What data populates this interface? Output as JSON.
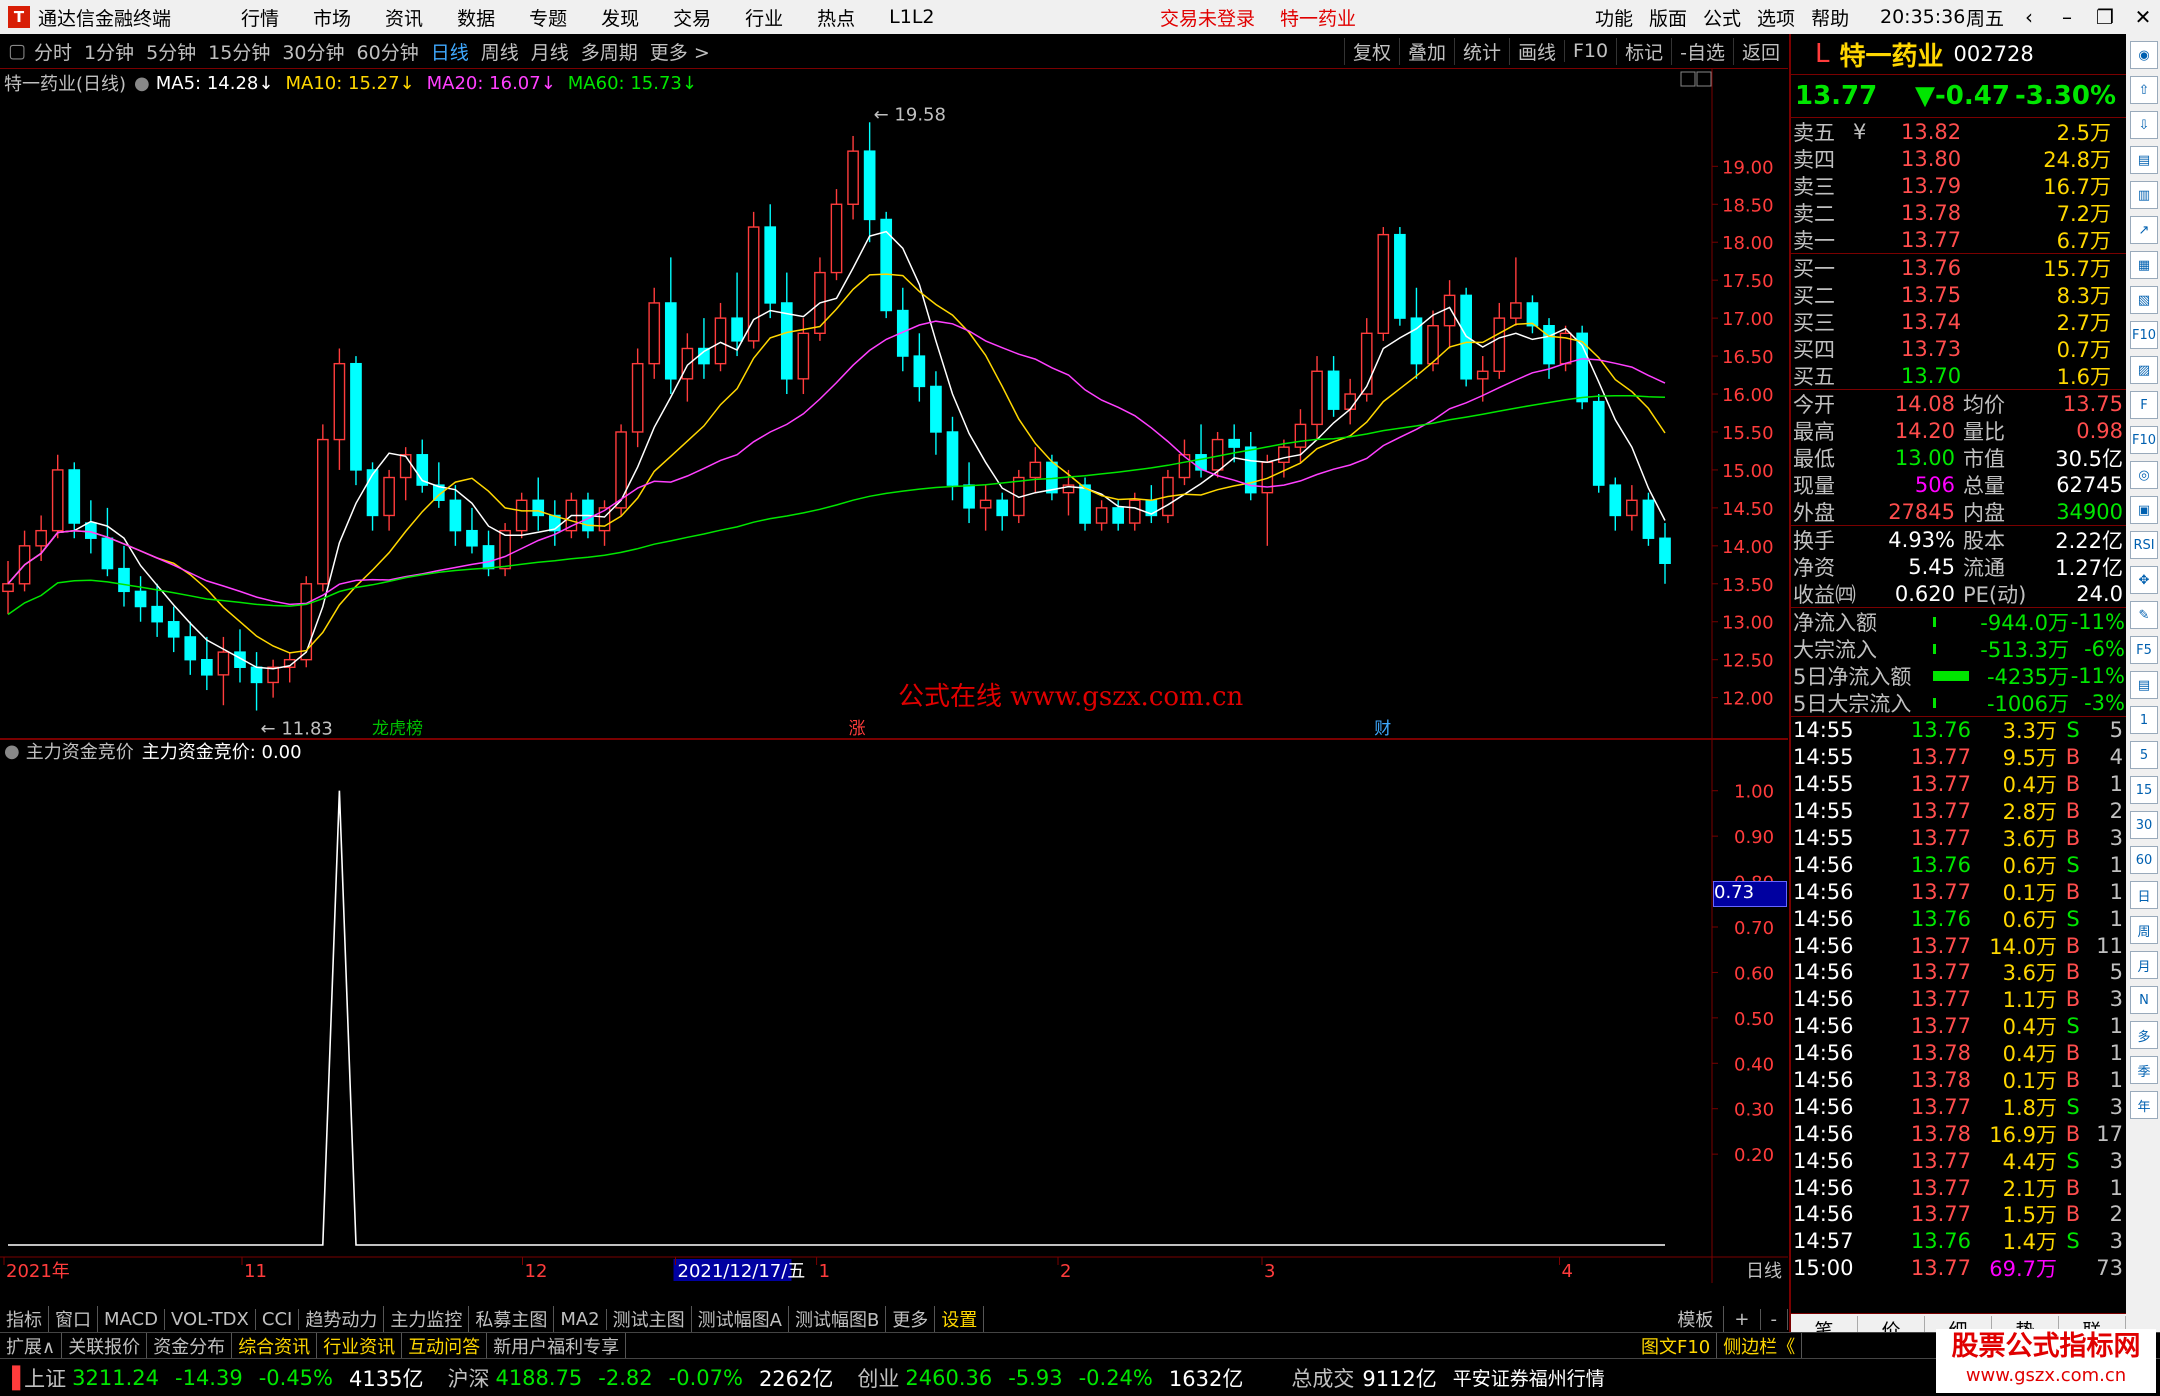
{
  "app": {
    "title": "通达信金融终端",
    "menus": [
      "行情",
      "市场",
      "资讯",
      "数据",
      "专题",
      "发现",
      "交易",
      "行业",
      "热点",
      "L1L2"
    ],
    "login_status": "交易未登录",
    "stock_name_header": "特一药业",
    "right_menus": [
      "功能",
      "版面",
      "公式",
      "选项",
      "帮助"
    ],
    "time": "20:35:36",
    "weekday": "周五",
    "logo_char": "T"
  },
  "period_bar": {
    "periods": [
      "分时",
      "1分钟",
      "5分钟",
      "15分钟",
      "30分钟",
      "60分钟",
      "日线",
      "周线",
      "月线",
      "多周期",
      "更多 >"
    ],
    "active": "日线",
    "tools": [
      "复权",
      "叠加",
      "统计",
      "画线",
      "F10",
      "标记",
      "-自选",
      "返回"
    ]
  },
  "main_chart": {
    "header_title": "特一药业(日线)",
    "ma": [
      {
        "label": "MA5: 14.28↓",
        "color": "#ffffff"
      },
      {
        "label": "MA10: 15.27↓",
        "color": "#ffd700"
      },
      {
        "label": "MA20: 16.07↓",
        "color": "#ff40ff"
      },
      {
        "label": "MA60: 15.73↓",
        "color": "#00e600"
      }
    ],
    "high_label": "19.58",
    "low_label": "11.83",
    "watermark": "公式在线 www.gszx.com.cn",
    "markers": [
      "龙虎榜",
      "涨",
      "财"
    ],
    "price_ticks": [
      "19.00",
      "18.50",
      "18.00",
      "17.50",
      "17.00",
      "16.50",
      "16.00",
      "15.50",
      "15.00",
      "14.50",
      "14.00",
      "13.50",
      "13.00",
      "12.50",
      "12.00"
    ]
  },
  "chart_data": [
    {
      "type": "candlestick",
      "title": "特一药业(日线)",
      "ylim": [
        11.6,
        19.9
      ],
      "high": 19.58,
      "low": 11.83,
      "x_labels": [
        "2021年",
        "11",
        "12",
        "2021/12/17/五",
        "1",
        "2",
        "3",
        "4"
      ],
      "ohlc": [
        [
          13.4,
          13.8,
          13.1,
          13.5
        ],
        [
          13.5,
          14.2,
          13.4,
          14.0
        ],
        [
          14.0,
          14.4,
          13.8,
          14.2
        ],
        [
          14.2,
          15.2,
          14.1,
          15.0
        ],
        [
          15.0,
          15.1,
          14.1,
          14.3
        ],
        [
          14.3,
          14.6,
          13.9,
          14.1
        ],
        [
          14.1,
          14.5,
          13.6,
          13.7
        ],
        [
          13.7,
          14.0,
          13.2,
          13.4
        ],
        [
          13.4,
          13.6,
          13.0,
          13.2
        ],
        [
          13.2,
          13.5,
          12.8,
          13.0
        ],
        [
          13.0,
          13.2,
          12.6,
          12.8
        ],
        [
          12.8,
          13.0,
          12.3,
          12.5
        ],
        [
          12.5,
          12.8,
          12.1,
          12.3
        ],
        [
          12.3,
          12.8,
          11.9,
          12.6
        ],
        [
          12.6,
          12.9,
          12.2,
          12.4
        ],
        [
          12.4,
          12.6,
          11.83,
          12.2
        ],
        [
          12.2,
          12.5,
          12.0,
          12.4
        ],
        [
          12.4,
          12.6,
          12.2,
          12.5
        ],
        [
          12.5,
          13.6,
          12.4,
          13.5
        ],
        [
          13.5,
          15.6,
          13.4,
          15.4
        ],
        [
          15.4,
          16.6,
          15.0,
          16.4
        ],
        [
          16.4,
          16.5,
          14.8,
          15.0
        ],
        [
          15.0,
          15.1,
          14.2,
          14.4
        ],
        [
          14.4,
          15.0,
          14.2,
          14.9
        ],
        [
          14.9,
          15.3,
          14.6,
          15.2
        ],
        [
          15.2,
          15.4,
          14.7,
          14.8
        ],
        [
          14.8,
          15.1,
          14.5,
          14.6
        ],
        [
          14.6,
          14.8,
          14.0,
          14.2
        ],
        [
          14.2,
          14.5,
          13.9,
          14.0
        ],
        [
          14.0,
          14.2,
          13.6,
          13.7
        ],
        [
          13.7,
          14.3,
          13.6,
          14.2
        ],
        [
          14.2,
          14.7,
          14.1,
          14.6
        ],
        [
          14.6,
          14.9,
          14.2,
          14.4
        ],
        [
          14.4,
          14.6,
          14.0,
          14.2
        ],
        [
          14.2,
          14.7,
          14.1,
          14.6
        ],
        [
          14.6,
          14.7,
          14.1,
          14.2
        ],
        [
          14.2,
          14.6,
          14.0,
          14.5
        ],
        [
          14.5,
          15.6,
          14.4,
          15.5
        ],
        [
          15.5,
          16.6,
          15.3,
          16.4
        ],
        [
          16.4,
          17.4,
          16.2,
          17.2
        ],
        [
          17.2,
          17.8,
          16.0,
          16.2
        ],
        [
          16.2,
          16.8,
          15.9,
          16.6
        ],
        [
          16.6,
          17.0,
          16.2,
          16.4
        ],
        [
          16.4,
          17.2,
          16.3,
          17.0
        ],
        [
          17.0,
          17.6,
          16.5,
          16.7
        ],
        [
          16.7,
          18.4,
          16.6,
          18.2
        ],
        [
          18.2,
          18.5,
          17.0,
          17.2
        ],
        [
          17.2,
          17.6,
          16.0,
          16.2
        ],
        [
          16.2,
          17.0,
          16.0,
          16.8
        ],
        [
          16.8,
          17.8,
          16.7,
          17.6
        ],
        [
          17.6,
          18.7,
          17.5,
          18.5
        ],
        [
          18.5,
          19.4,
          18.3,
          19.2
        ],
        [
          19.2,
          19.58,
          18.0,
          18.3
        ],
        [
          18.3,
          18.4,
          17.0,
          17.1
        ],
        [
          17.1,
          17.4,
          16.3,
          16.5
        ],
        [
          16.5,
          16.8,
          15.9,
          16.1
        ],
        [
          16.1,
          16.3,
          15.2,
          15.5
        ],
        [
          15.5,
          15.7,
          14.6,
          14.8
        ],
        [
          14.8,
          15.1,
          14.3,
          14.5
        ],
        [
          14.5,
          14.8,
          14.2,
          14.6
        ],
        [
          14.6,
          14.7,
          14.2,
          14.4
        ],
        [
          14.4,
          15.0,
          14.3,
          14.9
        ],
        [
          14.9,
          15.3,
          14.7,
          15.1
        ],
        [
          15.1,
          15.2,
          14.6,
          14.7
        ],
        [
          14.7,
          15.0,
          14.4,
          14.8
        ],
        [
          14.8,
          14.9,
          14.2,
          14.3
        ],
        [
          14.3,
          14.6,
          14.2,
          14.5
        ],
        [
          14.5,
          14.6,
          14.2,
          14.3
        ],
        [
          14.3,
          14.7,
          14.2,
          14.6
        ],
        [
          14.6,
          14.8,
          14.3,
          14.4
        ],
        [
          14.4,
          15.0,
          14.3,
          14.9
        ],
        [
          14.9,
          15.4,
          14.8,
          15.2
        ],
        [
          15.2,
          15.6,
          14.9,
          15.0
        ],
        [
          15.0,
          15.5,
          14.9,
          15.4
        ],
        [
          15.4,
          15.6,
          15.1,
          15.3
        ],
        [
          15.3,
          15.5,
          14.6,
          14.7
        ],
        [
          14.7,
          15.2,
          14.0,
          15.1
        ],
        [
          15.1,
          15.4,
          14.9,
          15.3
        ],
        [
          15.3,
          15.8,
          15.1,
          15.6
        ],
        [
          15.6,
          16.5,
          15.4,
          16.3
        ],
        [
          16.3,
          16.5,
          15.7,
          15.8
        ],
        [
          15.8,
          16.2,
          15.6,
          16.0
        ],
        [
          16.0,
          17.0,
          15.9,
          16.8
        ],
        [
          16.8,
          18.2,
          16.7,
          18.1
        ],
        [
          18.1,
          18.2,
          16.9,
          17.0
        ],
        [
          17.0,
          17.4,
          16.2,
          16.4
        ],
        [
          16.4,
          17.1,
          16.3,
          16.9
        ],
        [
          16.9,
          17.5,
          16.6,
          17.3
        ],
        [
          17.3,
          17.4,
          16.1,
          16.2
        ],
        [
          16.2,
          16.5,
          15.9,
          16.3
        ],
        [
          16.3,
          17.2,
          16.2,
          17.0
        ],
        [
          17.0,
          17.8,
          16.9,
          17.2
        ],
        [
          17.2,
          17.3,
          16.8,
          16.9
        ],
        [
          16.9,
          17.0,
          16.2,
          16.4
        ],
        [
          16.4,
          16.9,
          16.3,
          16.8
        ],
        [
          16.8,
          16.9,
          15.8,
          15.9
        ],
        [
          15.9,
          16.0,
          14.7,
          14.8
        ],
        [
          14.8,
          14.9,
          14.2,
          14.4
        ],
        [
          14.4,
          14.8,
          14.2,
          14.6
        ],
        [
          14.6,
          14.7,
          14.0,
          14.1
        ],
        [
          14.1,
          14.3,
          13.5,
          13.77
        ]
      ]
    },
    {
      "type": "line",
      "title": "主力资金竞价",
      "series": [
        {
          "name": "主力资金竞价",
          "peak_index": 20,
          "peak_value": 1.0,
          "last": 0.0
        }
      ],
      "ylim": [
        0,
        1.05
      ],
      "y_ticks": [
        "1.00",
        "0.90",
        "0.80",
        "0.70",
        "0.60",
        "0.50",
        "0.40",
        "0.30",
        "0.20"
      ],
      "cursor_value": "0.73"
    }
  ],
  "indicator": {
    "header": "主力资金竞价",
    "value_label": "主力资金竞价: 0.00",
    "cursor_value": "0.73"
  },
  "x_axis": {
    "labels": [
      {
        "text": "2021年",
        "pos": 0.0
      },
      {
        "text": "11",
        "pos": 0.14
      },
      {
        "text": "12",
        "pos": 0.305
      },
      {
        "text": "2021/12/17/五",
        "pos": 0.395,
        "highlight": true
      },
      {
        "text": "1",
        "pos": 0.478
      },
      {
        "text": "2",
        "pos": 0.62
      },
      {
        "text": "3",
        "pos": 0.74
      },
      {
        "text": "4",
        "pos": 0.915
      }
    ],
    "period_label": "日线"
  },
  "right_panel": {
    "prefix": "L",
    "name": "特一药业",
    "code": "002728",
    "price": "13.77",
    "change": "▼-0.47",
    "pct": "-3.30%",
    "asks": [
      {
        "label": "卖五",
        "sym": "¥",
        "price": "13.82",
        "vol": "2.5万"
      },
      {
        "label": "卖四",
        "sym": "",
        "price": "13.80",
        "vol": "24.8万"
      },
      {
        "label": "卖三",
        "sym": "",
        "price": "13.79",
        "vol": "16.7万"
      },
      {
        "label": "卖二",
        "sym": "",
        "price": "13.78",
        "vol": "7.2万"
      },
      {
        "label": "卖一",
        "sym": "",
        "price": "13.77",
        "vol": "6.7万"
      }
    ],
    "bids": [
      {
        "label": "买一",
        "price": "13.76",
        "vol": "15.7万"
      },
      {
        "label": "买二",
        "price": "13.75",
        "vol": "8.3万"
      },
      {
        "label": "买三",
        "price": "13.74",
        "vol": "2.7万"
      },
      {
        "label": "买四",
        "price": "13.73",
        "vol": "0.7万"
      },
      {
        "label": "买五",
        "price": "13.70",
        "vol": "1.6万"
      }
    ],
    "stats": [
      {
        "l1": "今开",
        "v1": "14.08",
        "c1": "up",
        "l2": "均价",
        "v2": "13.75",
        "c2": "up"
      },
      {
        "l1": "最高",
        "v1": "14.20",
        "c1": "up",
        "l2": "量比",
        "v2": "0.98",
        "c2": "up"
      },
      {
        "l1": "最低",
        "v1": "13.00",
        "c1": "dn",
        "l2": "市值",
        "v2": "30.5亿",
        "c2": "wh"
      },
      {
        "l1": "现量",
        "v1": "506",
        "c1": "mg",
        "l2": "总量",
        "v2": "62745",
        "c2": "wh"
      },
      {
        "l1": "外盘",
        "v1": "27845",
        "c1": "up",
        "l2": "内盘",
        "v2": "34900",
        "c2": "dn"
      }
    ],
    "stats2": [
      {
        "l1": "换手",
        "v1": "4.93%",
        "l2": "股本",
        "v2": "2.22亿"
      },
      {
        "l1": "净资",
        "v1": "5.45",
        "l2": "流通",
        "v2": "1.27亿"
      },
      {
        "l1": "收益㈣",
        "v1": "0.620",
        "l2": "PE(动)",
        "v2": "24.0"
      }
    ],
    "flows": [
      {
        "label": "净流入额",
        "value": "-944.0万",
        "pct": "-11%",
        "bar": 0.05
      },
      {
        "label": "大宗流入",
        "value": "-513.3万",
        "pct": "-6%",
        "bar": 0.02
      },
      {
        "label": "5日净流入额",
        "value": "-4235万",
        "pct": "-11%",
        "bar": 0.9
      },
      {
        "label": "5日大宗流入",
        "value": "-1006万",
        "pct": "-3%",
        "bar": 0.03
      }
    ],
    "ticks": [
      {
        "t": "14:55",
        "p": "13.76",
        "v": "3.3万",
        "s": "S",
        "n": "5"
      },
      {
        "t": "14:55",
        "p": "13.77",
        "v": "9.5万",
        "s": "B",
        "n": "4"
      },
      {
        "t": "14:55",
        "p": "13.77",
        "v": "0.4万",
        "s": "B",
        "n": "1"
      },
      {
        "t": "14:55",
        "p": "13.77",
        "v": "2.8万",
        "s": "B",
        "n": "2"
      },
      {
        "t": "14:55",
        "p": "13.77",
        "v": "3.6万",
        "s": "B",
        "n": "3"
      },
      {
        "t": "14:56",
        "p": "13.76",
        "v": "0.6万",
        "s": "S",
        "n": "1"
      },
      {
        "t": "14:56",
        "p": "13.77",
        "v": "0.1万",
        "s": "B",
        "n": "1"
      },
      {
        "t": "14:56",
        "p": "13.76",
        "v": "0.6万",
        "s": "S",
        "n": "1"
      },
      {
        "t": "14:56",
        "p": "13.77",
        "v": "14.0万",
        "s": "B",
        "n": "11"
      },
      {
        "t": "14:56",
        "p": "13.77",
        "v": "3.6万",
        "s": "B",
        "n": "5"
      },
      {
        "t": "14:56",
        "p": "13.77",
        "v": "1.1万",
        "s": "B",
        "n": "3"
      },
      {
        "t": "14:56",
        "p": "13.77",
        "v": "0.4万",
        "s": "S",
        "n": "1"
      },
      {
        "t": "14:56",
        "p": "13.78",
        "v": "0.4万",
        "s": "B",
        "n": "1"
      },
      {
        "t": "14:56",
        "p": "13.78",
        "v": "0.1万",
        "s": "B",
        "n": "1"
      },
      {
        "t": "14:56",
        "p": "13.77",
        "v": "1.8万",
        "s": "S",
        "n": "3"
      },
      {
        "t": "14:56",
        "p": "13.78",
        "v": "16.9万",
        "s": "B",
        "n": "17"
      },
      {
        "t": "14:56",
        "p": "13.77",
        "v": "4.4万",
        "s": "S",
        "n": "3"
      },
      {
        "t": "14:56",
        "p": "13.77",
        "v": "2.1万",
        "s": "B",
        "n": "1"
      },
      {
        "t": "14:56",
        "p": "13.77",
        "v": "1.5万",
        "s": "B",
        "n": "2"
      },
      {
        "t": "14:57",
        "p": "13.76",
        "v": "1.4万",
        "s": "S",
        "n": "3"
      },
      {
        "t": "15:00",
        "p": "13.77",
        "v": "69.7万",
        "s": "",
        "n": "73"
      }
    ],
    "bottom_tabs": [
      "笔",
      "价",
      "细",
      "势",
      "联"
    ]
  },
  "side_icons": [
    "◉",
    "⇧",
    "⇩",
    "▤",
    "▥",
    "↗",
    "▦",
    "▧",
    "F10",
    "▨",
    "F",
    "F10",
    "◎",
    "▣",
    "RSI",
    "✥",
    "✎",
    "F5",
    "▤",
    "1",
    "5",
    "15",
    "30",
    "60",
    "日",
    "周",
    "月",
    "N",
    "多",
    "季",
    "年"
  ],
  "bottom_tabs": [
    "指标",
    "窗口",
    "MACD",
    "VOL-TDX",
    "CCI",
    "趋势动力",
    "主力监控",
    "私募主图",
    "MA2",
    "测试主图",
    "测试幅图A",
    "测试幅图B",
    "更多",
    "设置"
  ],
  "bottom_tabs_right": [
    "模板",
    "+",
    "-"
  ],
  "sub_tabs": [
    "扩展∧",
    "关联报价",
    "资金分布",
    "综合资讯",
    "行业资讯",
    "互动问答",
    "新用户福利专享"
  ],
  "sub_tabs_right": [
    "图文F10",
    "侧边栏《"
  ],
  "status": [
    {
      "name": "上证",
      "value": "3211.24",
      "chg": "-14.39",
      "pct": "-0.45%",
      "amt": "4135亿"
    },
    {
      "name": "沪深",
      "value": "4188.75",
      "chg": "-2.82",
      "pct": "-0.07%",
      "amt": "2262亿"
    },
    {
      "name": "创业",
      "value": "2460.36",
      "chg": "-5.93",
      "pct": "-0.24%",
      "amt": "1632亿"
    }
  ],
  "status_total": {
    "label": "总成交",
    "value": "9112亿"
  },
  "status_broker": "平安证券福州行情",
  "site_badge": {
    "top": "股票公式指标网",
    "bottom": "www.gszx.com.cn"
  },
  "colors": {
    "up": "#ff3c3c",
    "down": "#00ffff",
    "ma5": "#ffffff",
    "ma10": "#ffd700",
    "ma20": "#ff40ff",
    "ma60": "#00e600",
    "grid": "#7a0000"
  }
}
